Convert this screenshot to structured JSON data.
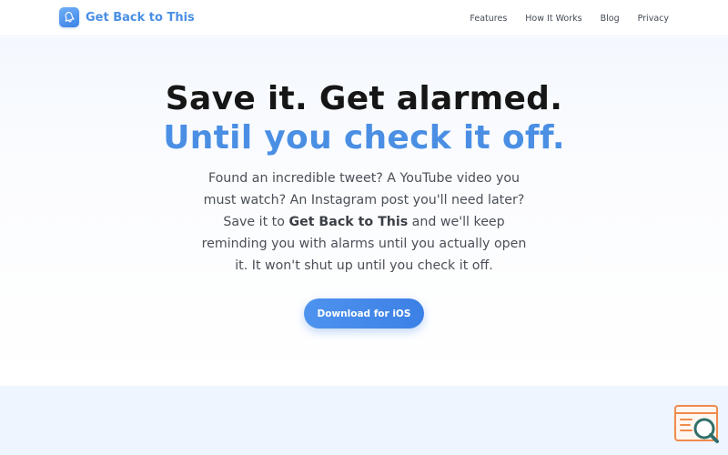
{
  "header": {
    "brand_name": "Get Back to This",
    "nav": [
      {
        "label": "Features"
      },
      {
        "label": "How It Works"
      },
      {
        "label": "Blog"
      },
      {
        "label": "Privacy"
      }
    ]
  },
  "hero": {
    "headline_line1": "Save it. Get alarmed.",
    "headline_line2": "Until you check it off.",
    "subtext_before": "Found an incredible tweet? A YouTube video you must watch? An Instagram post you'll need later? Save it to ",
    "subtext_app_name": "Get Back to This",
    "subtext_after": " and we'll keep reminding you with alarms until you actually open it. It won't shut up until you check it off.",
    "cta_label": "Download for iOS"
  },
  "colors": {
    "accent": "#4a8fe4",
    "headline": "#161616",
    "band": "#eef5fe",
    "widget_orange": "#f08a4b",
    "widget_teal": "#2f6f6a"
  },
  "icons": {
    "brand_logo": "bell-icon",
    "widget": "search-magnifier-icon"
  }
}
